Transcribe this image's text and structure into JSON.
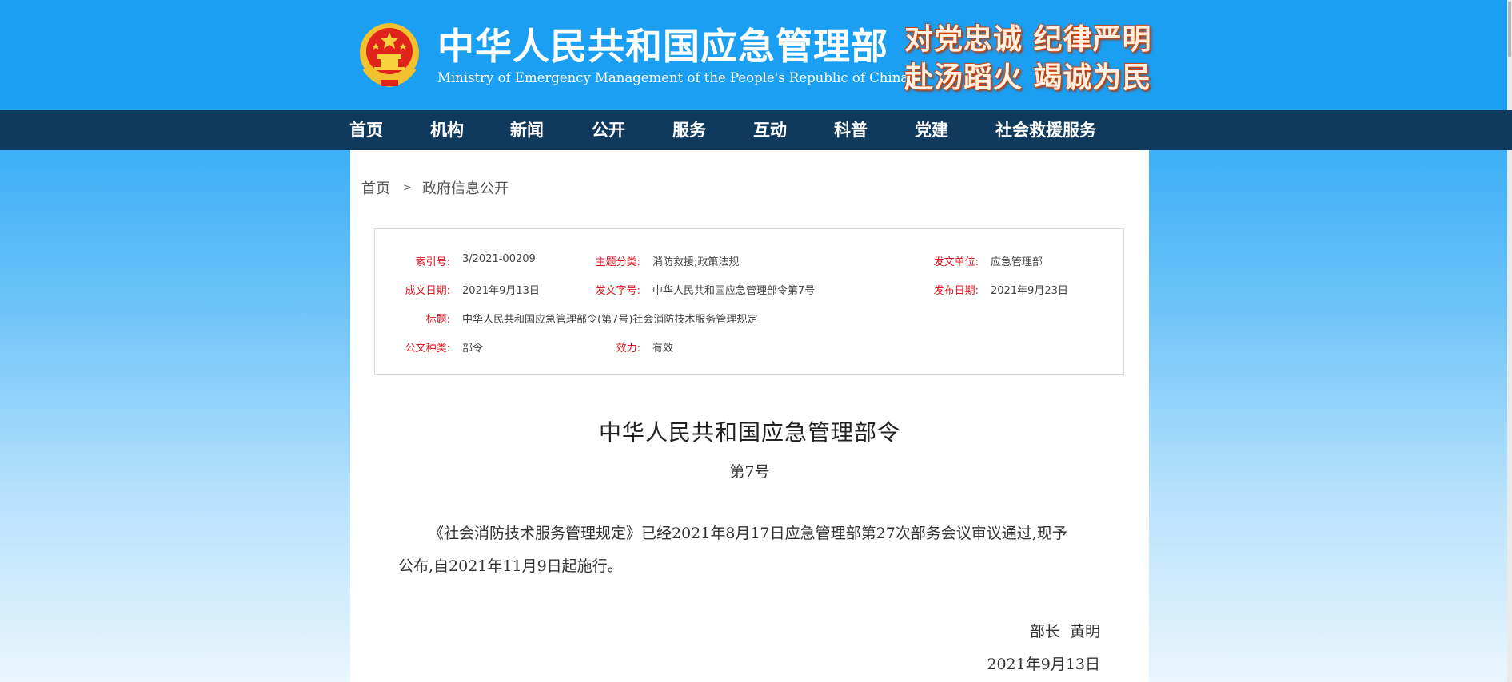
{
  "header": {
    "title": "中华人民共和国应急管理部",
    "subtitle": "Ministry of Emergency Management of the People's Republic of China",
    "slogan_line1": "对党忠诚 纪律严明",
    "slogan_line2": "赴汤蹈火 竭诚为民",
    "emblem_icon": "national-emblem-icon"
  },
  "nav": {
    "items": [
      "首页",
      "机构",
      "新闻",
      "公开",
      "服务",
      "互动",
      "科普",
      "党建",
      "社会救援服务"
    ]
  },
  "breadcrumb": {
    "home": "首页",
    "separator": ">",
    "current": "政府信息公开"
  },
  "meta": {
    "index_label": "索引号:",
    "index_value": "3/2021-00209",
    "topic_label": "主题分类:",
    "topic_value": "消防救援;政策法规",
    "issuer_label": "发文单位:",
    "issuer_value": "应急管理部",
    "written_date_label": "成文日期:",
    "written_date_value": "2021年9月13日",
    "doc_no_label": "发文字号:",
    "doc_no_value": "中华人民共和国应急管理部令第7号",
    "publish_date_label": "发布日期:",
    "publish_date_value": "2021年9月23日",
    "title_label": "标题:",
    "title_value": "中华人民共和国应急管理部令(第7号)社会消防技术服务管理规定",
    "type_label": "公文种类:",
    "type_value": "部令",
    "validity_label": "效力:",
    "validity_value": "有效"
  },
  "document": {
    "title": "中华人民共和国应急管理部令",
    "number": "第7号",
    "body": "《社会消防技术服务管理规定》已经2021年8月17日应急管理部第27次部务会议审议通过,现予公布,自2021年11月9日起施行。",
    "signatory": "部长  黄明",
    "date": "2021年9月13日"
  },
  "colors": {
    "header_blue": "#1b9ff2",
    "nav_navy": "#0f3a5e",
    "label_red": "#e0141e",
    "slogan_orange": "#d04a10"
  }
}
